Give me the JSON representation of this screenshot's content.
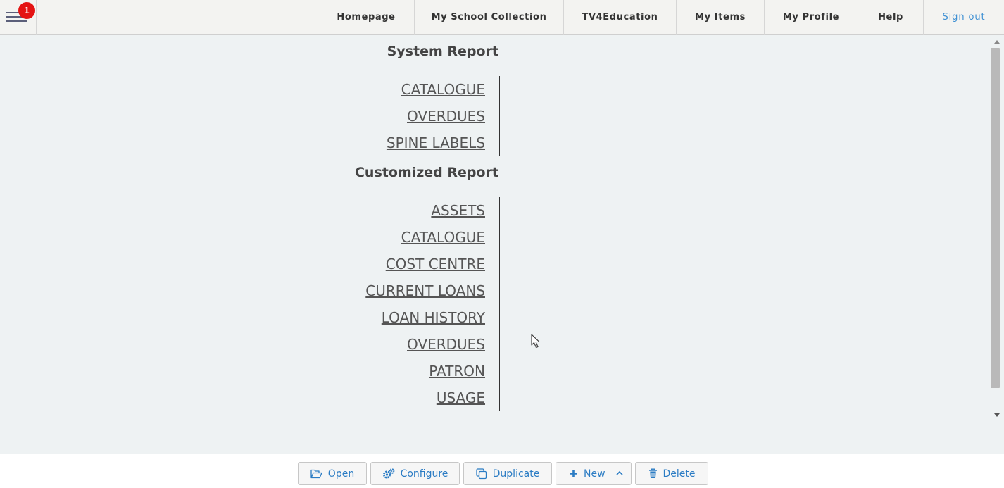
{
  "notifications": {
    "count": "1"
  },
  "nav": {
    "items": [
      {
        "label": "Homepage"
      },
      {
        "label": "My School Collection"
      },
      {
        "label": "TV4Education"
      },
      {
        "label": "My Items"
      },
      {
        "label": "My Profile"
      },
      {
        "label": "Help"
      },
      {
        "label": "Sign out"
      }
    ]
  },
  "system_report": {
    "title": "System Report",
    "links": [
      "CATALOGUE",
      "OVERDUES",
      "SPINE LABELS"
    ]
  },
  "customized_report": {
    "title": "Customized Report",
    "links": [
      "ASSETS",
      "CATALOGUE",
      "COST CENTRE",
      "CURRENT LOANS",
      "LOAN HISTORY",
      "OVERDUES",
      "PATRON",
      "USAGE"
    ]
  },
  "toolbar": {
    "open_label": "Open",
    "configure_label": "Configure",
    "duplicate_label": "Duplicate",
    "new_label": "New",
    "delete_label": "Delete"
  },
  "icons": {
    "menu": "hamburger-icon",
    "open": "folder-open-icon",
    "configure": "gears-icon",
    "duplicate": "copy-icon",
    "new": "plus-icon",
    "more": "chevron-up-icon",
    "delete": "trash-icon"
  },
  "colors": {
    "accent": "#2b7cc4",
    "badge": "#e41313",
    "sign_out": "#3d8fd3",
    "background": "#eef2f3"
  }
}
